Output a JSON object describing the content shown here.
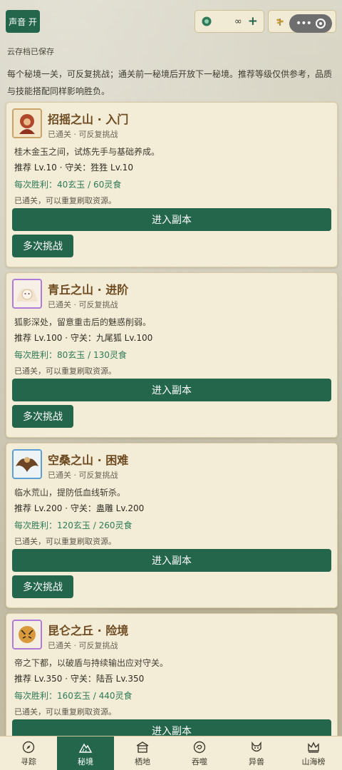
{
  "top": {
    "sound_label": "声音 开",
    "jade_value": "∞",
    "jade_plus": "+",
    "food_value": "∞"
  },
  "cloud_note": "云存档已保存",
  "intro_text": "每个秘境一关，可反复挑战；通关前一秘境后开放下一秘境。推荐等级仅供参考，品质与技能搭配同样影响胜负。",
  "cards": [
    {
      "title": "招摇之山 · 入门",
      "cleared": "已通关 · 可反复挑战",
      "desc": "桂木金玉之间，试炼先手与基础养成。",
      "rec": "推荐 Lv.10 · 守关：狌狌 Lv.10",
      "reward": "每次胜利：40玄玉 / 60灵食",
      "note": "已通关，可以重复刷取资源。",
      "enter": "进入副本",
      "multi": "多次挑战"
    },
    {
      "title": "青丘之山 · 进阶",
      "cleared": "已通关 · 可反复挑战",
      "desc": "狐影深处，留意重击后的魅惑削弱。",
      "rec": "推荐 Lv.100 · 守关：九尾狐 Lv.100",
      "reward": "每次胜利：80玄玉 / 130灵食",
      "note": "已通关，可以重复刷取资源。",
      "enter": "进入副本",
      "multi": "多次挑战"
    },
    {
      "title": "空桑之山 · 困难",
      "cleared": "已通关 · 可反复挑战",
      "desc": "临水荒山，提防低血线斩杀。",
      "rec": "推荐 Lv.200 · 守关：蛊雕 Lv.200",
      "reward": "每次胜利：120玄玉 / 260灵食",
      "note": "已通关，可以重复刷取资源。",
      "enter": "进入副本",
      "multi": "多次挑战"
    },
    {
      "title": "昆仑之丘 · 险境",
      "cleared": "已通关 · 可反复挑战",
      "desc": "帝之下都，以破盾与持续输出应对守关。",
      "rec": "推荐 Lv.350 · 守关：陆吾 Lv.350",
      "reward": "每次胜利：160玄玉 / 440灵食",
      "note": "已通关，可以重复刷取资源。",
      "enter": "进入副本"
    }
  ],
  "nav": [
    {
      "label": "寻踪",
      "icon": "compass-icon"
    },
    {
      "label": "秘境",
      "icon": "mountain-icon"
    },
    {
      "label": "栖地",
      "icon": "house-icon"
    },
    {
      "label": "吞噬",
      "icon": "swirl-icon"
    },
    {
      "label": "异兽",
      "icon": "beast-icon"
    },
    {
      "label": "山海榜",
      "icon": "crown-icon"
    }
  ],
  "colors": {
    "primary": "#23664b",
    "card_bg": "#f3ecd7",
    "title_brown": "#6e4b21",
    "reward_green": "#2e7a57"
  }
}
